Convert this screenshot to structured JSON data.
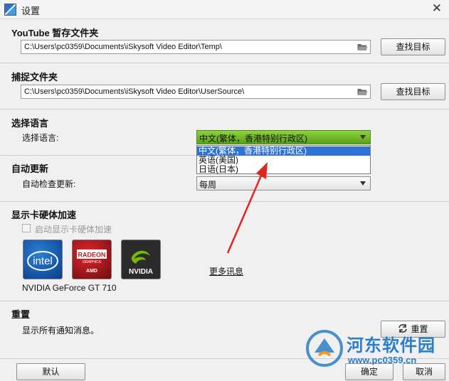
{
  "window": {
    "title": "设置",
    "close_symbol": "✕"
  },
  "youtube_temp": {
    "section_title": "YouTube 暂存文件夹",
    "path": "C:\\Users\\pc0359\\Documents\\iSkysoft Video Editor\\Temp\\",
    "browse_label": "查找目标"
  },
  "capture": {
    "section_title": "捕捉文件夹",
    "path": "C:\\Users\\pc0359\\Documents\\iSkysoft Video Editor\\UserSource\\",
    "browse_label": "查找目标"
  },
  "language": {
    "section_title": "选择语言",
    "label": "选择语言:",
    "selected": "中文(繁体，香港特别行政区)",
    "options": [
      "中文(繁体，香港特别行政区)",
      "英语(美国)",
      "日语(日本)"
    ]
  },
  "auto_update": {
    "section_title": "自动更新",
    "label": "自动检查更新:",
    "selected": "每周"
  },
  "gpu": {
    "section_title": "显示卡硬体加速",
    "checkbox_label": "启动显示卡硬体加速",
    "checked": false,
    "logos": [
      {
        "name": "intel-logo",
        "text": "intel"
      },
      {
        "name": "amd-logo",
        "text": "RADEON",
        "sub": "GRAPHICS",
        "sub2": "AMD"
      },
      {
        "name": "nvidia-logo",
        "text": "NVIDIA"
      }
    ],
    "card_name": "NVIDIA GeForce GT 710",
    "more_info": "更多讯息"
  },
  "reset": {
    "section_title": "重置",
    "description": "显示所有通知消息。",
    "button_label": "重置"
  },
  "footer": {
    "default_label": "默认",
    "ok_label": "确定",
    "cancel_label": "取消"
  },
  "watermark": {
    "title": "河东软件园",
    "url": "www.pc0359.cn"
  },
  "colors": {
    "dropdown_active": "#6fb82a",
    "selection": "#2f72d6",
    "annotation_arrow": "#e0261f",
    "watermark": "#2b7ec8"
  }
}
